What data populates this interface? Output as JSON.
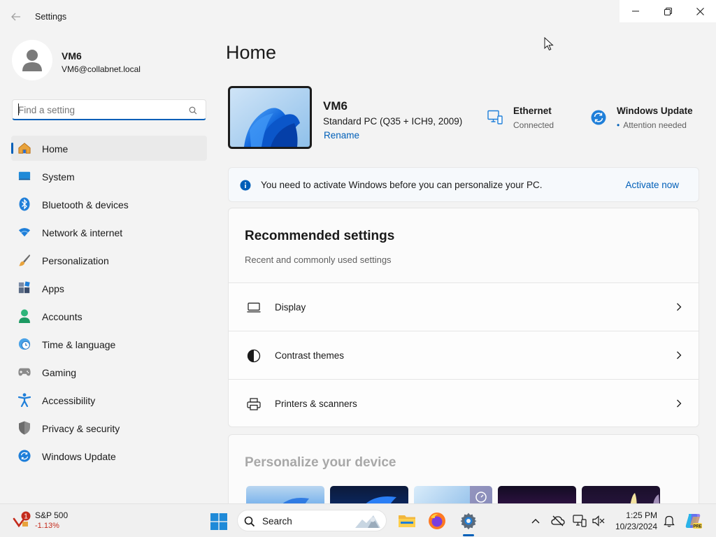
{
  "window": {
    "title": "Settings",
    "controls": {
      "minimize": "minimize",
      "maximize": "restore",
      "close": "close"
    }
  },
  "profile": {
    "name": "VM6",
    "email": "VM6@collabnet.local"
  },
  "search": {
    "placeholder": "Find a setting",
    "value": ""
  },
  "sidebar": {
    "items": [
      {
        "label": "Home",
        "icon": "home-icon",
        "active": true
      },
      {
        "label": "System",
        "icon": "system-icon"
      },
      {
        "label": "Bluetooth & devices",
        "icon": "bluetooth-icon"
      },
      {
        "label": "Network & internet",
        "icon": "wifi-icon"
      },
      {
        "label": "Personalization",
        "icon": "brush-icon"
      },
      {
        "label": "Apps",
        "icon": "apps-icon"
      },
      {
        "label": "Accounts",
        "icon": "accounts-icon"
      },
      {
        "label": "Time & language",
        "icon": "clock-globe-icon"
      },
      {
        "label": "Gaming",
        "icon": "gamepad-icon"
      },
      {
        "label": "Accessibility",
        "icon": "accessibility-icon"
      },
      {
        "label": "Privacy & security",
        "icon": "shield-icon"
      },
      {
        "label": "Windows Update",
        "icon": "update-icon"
      }
    ]
  },
  "main": {
    "title": "Home",
    "device": {
      "name": "VM6",
      "model": "Standard PC (Q35 + ICH9, 2009)",
      "rename_label": "Rename"
    },
    "ethernet": {
      "title": "Ethernet",
      "status": "Connected"
    },
    "windows_update": {
      "title": "Windows Update",
      "dot": "•",
      "status": "Attention needed"
    },
    "activation": {
      "message": "You need to activate Windows before you can personalize your PC.",
      "button": "Activate now"
    },
    "recommended": {
      "title": "Recommended settings",
      "subtitle": "Recent and commonly used settings",
      "items": [
        {
          "label": "Display",
          "icon": "monitor-icon"
        },
        {
          "label": "Contrast themes",
          "icon": "contrast-icon"
        },
        {
          "label": "Printers & scanners",
          "icon": "printer-icon"
        }
      ]
    },
    "personalize": {
      "title": "Personalize your device"
    }
  },
  "taskbar": {
    "widget": {
      "name": "S&P 500",
      "change": "-1.13%",
      "badge": "1"
    },
    "search_label": "Search",
    "apps": [
      "windows-start",
      "file-explorer",
      "firefox",
      "settings"
    ],
    "clock": {
      "time": "1:25 PM",
      "date": "10/23/2024"
    }
  },
  "colors": {
    "accent": "#005fb8",
    "negative": "#c42b1c",
    "background": "#f3f3f3"
  }
}
